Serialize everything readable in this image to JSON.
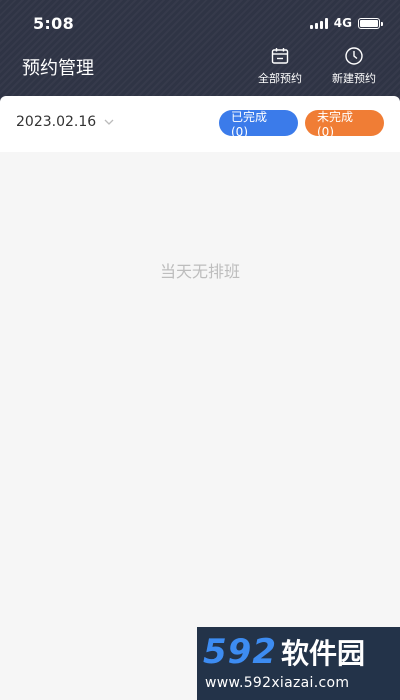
{
  "status_bar": {
    "time": "5:08",
    "network": "4G"
  },
  "header": {
    "title": "预约管理",
    "actions": [
      {
        "label": "全部预约",
        "icon": "calendar-icon"
      },
      {
        "label": "新建预约",
        "icon": "clock-icon"
      }
    ]
  },
  "filter": {
    "date": "2023.02.16",
    "done_label": "已完成 (0)",
    "undone_label": "未完成 (0)"
  },
  "empty_state": {
    "message": "当天无排班"
  },
  "watermark": {
    "logo_number": "592",
    "logo_text": "软件园",
    "url": "www.592xiazai.com"
  },
  "colors": {
    "header_bg": "#2f3445",
    "done_pill": "#3b7bea",
    "undone_pill": "#f07d35",
    "page_bg": "#f6f6f6"
  }
}
